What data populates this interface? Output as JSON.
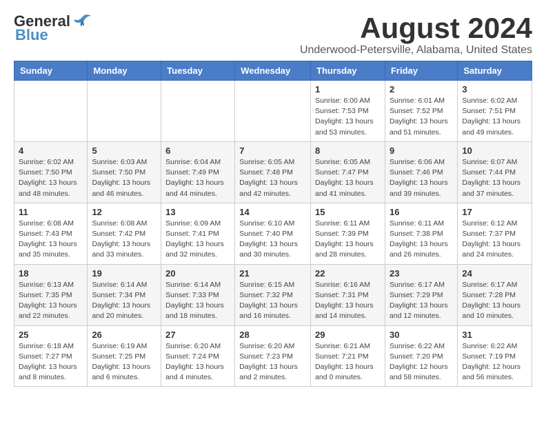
{
  "header": {
    "logo_line1": "General",
    "logo_line2": "Blue",
    "month_title": "August 2024",
    "location": "Underwood-Petersville, Alabama, United States"
  },
  "weekdays": [
    "Sunday",
    "Monday",
    "Tuesday",
    "Wednesday",
    "Thursday",
    "Friday",
    "Saturday"
  ],
  "weeks": [
    [
      {
        "day": "",
        "info": ""
      },
      {
        "day": "",
        "info": ""
      },
      {
        "day": "",
        "info": ""
      },
      {
        "day": "",
        "info": ""
      },
      {
        "day": "1",
        "info": "Sunrise: 6:00 AM\nSunset: 7:53 PM\nDaylight: 13 hours\nand 53 minutes."
      },
      {
        "day": "2",
        "info": "Sunrise: 6:01 AM\nSunset: 7:52 PM\nDaylight: 13 hours\nand 51 minutes."
      },
      {
        "day": "3",
        "info": "Sunrise: 6:02 AM\nSunset: 7:51 PM\nDaylight: 13 hours\nand 49 minutes."
      }
    ],
    [
      {
        "day": "4",
        "info": "Sunrise: 6:02 AM\nSunset: 7:50 PM\nDaylight: 13 hours\nand 48 minutes."
      },
      {
        "day": "5",
        "info": "Sunrise: 6:03 AM\nSunset: 7:50 PM\nDaylight: 13 hours\nand 46 minutes."
      },
      {
        "day": "6",
        "info": "Sunrise: 6:04 AM\nSunset: 7:49 PM\nDaylight: 13 hours\nand 44 minutes."
      },
      {
        "day": "7",
        "info": "Sunrise: 6:05 AM\nSunset: 7:48 PM\nDaylight: 13 hours\nand 42 minutes."
      },
      {
        "day": "8",
        "info": "Sunrise: 6:05 AM\nSunset: 7:47 PM\nDaylight: 13 hours\nand 41 minutes."
      },
      {
        "day": "9",
        "info": "Sunrise: 6:06 AM\nSunset: 7:46 PM\nDaylight: 13 hours\nand 39 minutes."
      },
      {
        "day": "10",
        "info": "Sunrise: 6:07 AM\nSunset: 7:44 PM\nDaylight: 13 hours\nand 37 minutes."
      }
    ],
    [
      {
        "day": "11",
        "info": "Sunrise: 6:08 AM\nSunset: 7:43 PM\nDaylight: 13 hours\nand 35 minutes."
      },
      {
        "day": "12",
        "info": "Sunrise: 6:08 AM\nSunset: 7:42 PM\nDaylight: 13 hours\nand 33 minutes."
      },
      {
        "day": "13",
        "info": "Sunrise: 6:09 AM\nSunset: 7:41 PM\nDaylight: 13 hours\nand 32 minutes."
      },
      {
        "day": "14",
        "info": "Sunrise: 6:10 AM\nSunset: 7:40 PM\nDaylight: 13 hours\nand 30 minutes."
      },
      {
        "day": "15",
        "info": "Sunrise: 6:11 AM\nSunset: 7:39 PM\nDaylight: 13 hours\nand 28 minutes."
      },
      {
        "day": "16",
        "info": "Sunrise: 6:11 AM\nSunset: 7:38 PM\nDaylight: 13 hours\nand 26 minutes."
      },
      {
        "day": "17",
        "info": "Sunrise: 6:12 AM\nSunset: 7:37 PM\nDaylight: 13 hours\nand 24 minutes."
      }
    ],
    [
      {
        "day": "18",
        "info": "Sunrise: 6:13 AM\nSunset: 7:35 PM\nDaylight: 13 hours\nand 22 minutes."
      },
      {
        "day": "19",
        "info": "Sunrise: 6:14 AM\nSunset: 7:34 PM\nDaylight: 13 hours\nand 20 minutes."
      },
      {
        "day": "20",
        "info": "Sunrise: 6:14 AM\nSunset: 7:33 PM\nDaylight: 13 hours\nand 18 minutes."
      },
      {
        "day": "21",
        "info": "Sunrise: 6:15 AM\nSunset: 7:32 PM\nDaylight: 13 hours\nand 16 minutes."
      },
      {
        "day": "22",
        "info": "Sunrise: 6:16 AM\nSunset: 7:31 PM\nDaylight: 13 hours\nand 14 minutes."
      },
      {
        "day": "23",
        "info": "Sunrise: 6:17 AM\nSunset: 7:29 PM\nDaylight: 13 hours\nand 12 minutes."
      },
      {
        "day": "24",
        "info": "Sunrise: 6:17 AM\nSunset: 7:28 PM\nDaylight: 13 hours\nand 10 minutes."
      }
    ],
    [
      {
        "day": "25",
        "info": "Sunrise: 6:18 AM\nSunset: 7:27 PM\nDaylight: 13 hours\nand 8 minutes."
      },
      {
        "day": "26",
        "info": "Sunrise: 6:19 AM\nSunset: 7:25 PM\nDaylight: 13 hours\nand 6 minutes."
      },
      {
        "day": "27",
        "info": "Sunrise: 6:20 AM\nSunset: 7:24 PM\nDaylight: 13 hours\nand 4 minutes."
      },
      {
        "day": "28",
        "info": "Sunrise: 6:20 AM\nSunset: 7:23 PM\nDaylight: 13 hours\nand 2 minutes."
      },
      {
        "day": "29",
        "info": "Sunrise: 6:21 AM\nSunset: 7:21 PM\nDaylight: 13 hours\nand 0 minutes."
      },
      {
        "day": "30",
        "info": "Sunrise: 6:22 AM\nSunset: 7:20 PM\nDaylight: 12 hours\nand 58 minutes."
      },
      {
        "day": "31",
        "info": "Sunrise: 6:22 AM\nSunset: 7:19 PM\nDaylight: 12 hours\nand 56 minutes."
      }
    ]
  ]
}
